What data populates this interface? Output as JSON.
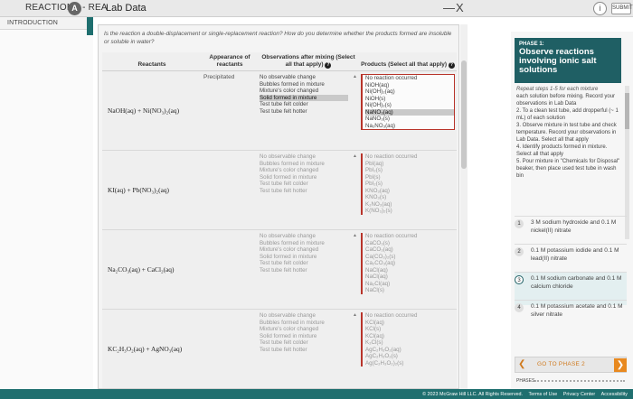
{
  "header": {
    "app_title": "REACTIONS - REA",
    "tab_icon": "A",
    "window_title": "Lab Data",
    "min_icon": "—",
    "close_icon": "X",
    "info_icon": "i",
    "submit_label": "SUBMIT"
  },
  "sidebar": {
    "intro_tab": "INTRODUCTION"
  },
  "question": "Is the reaction a double-displacement or single-replacement reaction? How do you determine whether the products formed are insoluble or soluble in water?",
  "table": {
    "headers": {
      "reactants": "Reactants",
      "appearance": "Appearance of reactants",
      "observations": "Observations after mixing (Select all that apply)",
      "products": "Products (Select all that apply)",
      "info_mark": "?"
    },
    "rows": [
      {
        "reactants": "NaOH(aq) + Ni(NO₃)₂(aq)",
        "appearance": "Precipitated",
        "observations": [
          "No observable change",
          "Bubbles formed in mixture",
          "Mixture's color changed",
          "Solid formed in mixture",
          "Test tube felt colder",
          "Test tube felt hotter"
        ],
        "products": [
          "No reaction occurred",
          "NiOH(aq)",
          "Ni(OH)₂(aq)",
          "NiOH(s)",
          "Ni(OH)₂(s)",
          "NaNO₃(aq)",
          "NaNO₃(s)",
          "Na₂NO₃(aq)"
        ]
      },
      {
        "reactants": "KI(aq) + Pb(NO₃)₂(aq)",
        "appearance": "",
        "observations": [
          "No observable change",
          "Bubbles formed in mixture",
          "Mixture's color changed",
          "Solid formed in mixture",
          "Test tube felt colder",
          "Test tube felt hotter"
        ],
        "products": [
          "No reaction occurred",
          "PbI(aq)",
          "PbI₂(s)",
          "PbI(s)",
          "PbI₂(s)",
          "KNO₃(aq)",
          "KNO₃(s)",
          "K₂NO₃(aq)",
          "K(NO₃)₂(s)"
        ]
      },
      {
        "reactants": "Na₂CO₃(aq) + CaCl₂(aq)",
        "appearance": "",
        "observations": [
          "No observable change",
          "Bubbles formed in mixture",
          "Mixture's color changed",
          "Solid formed in mixture",
          "Test tube felt colder",
          "Test tube felt hotter"
        ],
        "products": [
          "No reaction occurred",
          "CaCO₃(s)",
          "CaCO₃(aq)",
          "Ca(CO₃)₂(s)",
          "Ca₂CO₃(aq)",
          "NaCl(aq)",
          "NaCl(aq)",
          "Na₂Cl(aq)",
          "NaCl(s)"
        ]
      },
      {
        "reactants": "KC₂H₃O₂(aq) + AgNO₃(aq)",
        "appearance": "",
        "observations": [
          "No observable change",
          "Bubbles formed in mixture",
          "Mixture's color changed",
          "Solid formed in mixture",
          "Test tube felt colder",
          "Test tube felt hotter"
        ],
        "products": [
          "No reaction occurred",
          "KCl(aq)",
          "KCl(s)",
          "KCl(aq)",
          "K₂Cl(s)",
          "AgC₂H₃O₂(aq)",
          "AgC₂H₃O₂(s)",
          "Ag(C₂H₃O₂)₂(s)"
        ]
      }
    ]
  },
  "phase": {
    "number": "PHASE 1:",
    "title": "Observe reactions involving ionic salt solutions",
    "instructions_header": "Repeat steps 1-5 for each mixture",
    "instructions": [
      "each solution before mixing. Record your observations in Lab Data",
      "2. To a clean test tube, add dropperful (~ 1 mL) of each solution",
      "3. Observe mixture in test tube and check temperature. Record your observations in Lab Data. Select all that apply",
      "4. Identify products formed in mixture. Select all that apply",
      "5. Pour mixture in \"Chemicals for Disposal\" beaker, then place used test tube in wash bin"
    ],
    "combos": [
      {
        "num": "1",
        "text": "3 M sodium hydroxide and 0.1 M nickel(II) nitrate"
      },
      {
        "num": "2",
        "text": "0.1 M potassium iodide and 0.1 M lead(II) nitrate"
      },
      {
        "num": "3",
        "text": "0.1 M sodium carbonate and 0.1 M calcium chloride"
      },
      {
        "num": "4",
        "text": "0.1 M potassium acetate and 0.1 M silver nitrate"
      }
    ],
    "goto_label": "GO TO PHASE 2",
    "phases_label": "PHASES"
  },
  "footer": {
    "copyright": "© 2023 McGraw Hill LLC. All Rights Reserved.",
    "terms": "Terms of Use",
    "privacy": "Privacy Center",
    "accessibility": "Accessibility"
  }
}
